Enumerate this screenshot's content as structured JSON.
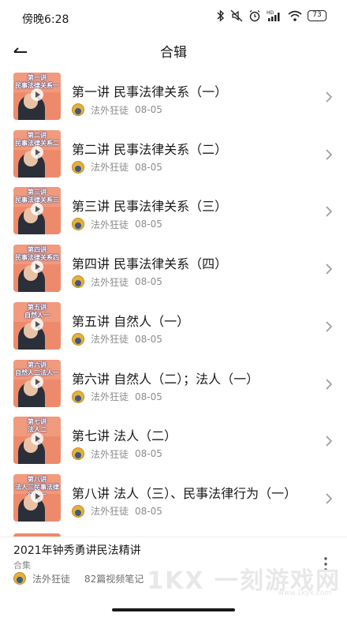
{
  "status_bar": {
    "time": "傍晚6:28",
    "battery": "73",
    "icons": [
      "bluetooth-icon",
      "mute-icon",
      "alarm-icon",
      "hd-signal-icon",
      "wifi-icon",
      "battery-icon"
    ]
  },
  "nav": {
    "title": "合辑",
    "back_icon": "back-arrow-icon"
  },
  "episodes": [
    {
      "title": "第一讲 民事法律关系（一）",
      "thumb_caption": "第一讲\n民事法律关系一",
      "author": "法外狂徒",
      "date": "08-05"
    },
    {
      "title": "第二讲 民事法律关系（二）",
      "thumb_caption": "第二讲\n民事法律关系二",
      "author": "法外狂徒",
      "date": "08-05"
    },
    {
      "title": "第三讲 民事法律关系（三）",
      "thumb_caption": "第三讲\n民事法律关系三",
      "author": "法外狂徒",
      "date": "08-05"
    },
    {
      "title": "第四讲 民事法律关系（四）",
      "thumb_caption": "第四讲\n民事法律关系四",
      "author": "法外狂徒",
      "date": "08-05"
    },
    {
      "title": "第五讲 自然人（一）",
      "thumb_caption": "第五讲\n自然人一",
      "author": "法外狂徒",
      "date": "08-05"
    },
    {
      "title": "第六讲 自然人（二）；法人（一）",
      "thumb_caption": "第六讲\n自然人二法人一",
      "author": "法外狂徒",
      "date": "08-05"
    },
    {
      "title": "第七讲 法人（二）",
      "thumb_caption": "第七讲\n法人二",
      "author": "法外狂徒",
      "date": "08-05"
    },
    {
      "title": "第八讲 法人（三）、民事法律行为（一）",
      "thumb_caption": "第八讲\n法人三民事法律行为一",
      "author": "法外狂徒",
      "date": "08-05"
    }
  ],
  "footer": {
    "collection_title": "2021年钟秀勇讲民法精讲",
    "label": "合集",
    "author": "法外狂徒",
    "count": "82篇视频笔记",
    "watermark": "1KX 一刻游戏网",
    "watermark_url": "www.1kyx.com"
  },
  "colors": {
    "thumb_bg": "#ee8a6c",
    "text_primary": "#1a1a1a",
    "text_secondary": "#8c8c8c"
  }
}
